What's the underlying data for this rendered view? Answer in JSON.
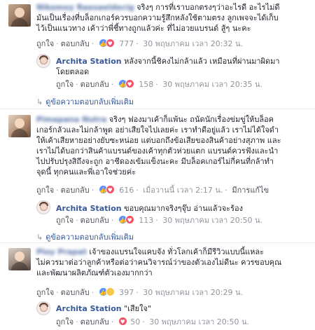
{
  "common": {
    "like": "ถูกใจ",
    "reply": "ตอบกลับ",
    "dot": "·",
    "view_more_replies": "ดูข้อความตอบกลับเพิ่มเติม",
    "edited": "มีการแก้ไข"
  },
  "comments": [
    {
      "author": "Nikomoy Raesaeldecig",
      "lines": [
        "จริงๆ การที่เราบอกตรงๆว่าอะไรดี อะไรไม่ดี",
        "มันเป็นเรื่องที่บล็อกเกอร์ควรบอกความรู้สึกหลังใช้ตามตรง ลูกเพจจะได้เก็บ",
        "ไว้เป็นแนวทาง เค้าว่าพี่ชี้ทางถูกแล้วค่ะ ที่ไม่อวยแบรนด์ สู้ๆ นะคะ"
      ],
      "reactions": "777",
      "time": "30 พฤษภาคม เวลา 20:32 น.",
      "reply": {
        "author": "Archita Station",
        "lines": [
          "หลังจากนี้ชิคงไม่กล้าแล้ว เหมือนที่ผ่านมาผิดมา",
          "โดยตลอด"
        ],
        "reactions": "158",
        "time": "30 พฤษภาคม เวลา 20:35 น."
      }
    },
    {
      "author": "Pimapana Nutra",
      "lines": [
        "จริงๆ ฟองมาเค้าก็แพ้นะ ถนัดนักเรื่องข่มขู่ให้บล็อค",
        "เกอร์กลัวและไม่กล้าพูด อย่าเสียใจไปเลยค่ะ เราทำดีอยู่แล้ว เราไม่ได้ใจดำ",
        "ให้เค้าเสียหายอย่างยับซะหน่อย แต่บอกถึงข้อเสียของสินค้าอย่างสุภาพ และ",
        "เราไม่ได้บอกว่าสินค้าแบรนด์ของเค้าทุกตัวห่วยแตก แบรนด์ควรฟังและนำ",
        "ไปปรับปรุงสิถึงจะถูก อาชีดองเข้มแข็งนะคะ มีบล็อคเกอร์ไม่กี่คนที่กล้าทำ",
        "จุดนี้ ทุกคนและพี่เอาใจช่วยค่ะ"
      ],
      "reactions": "616",
      "time": "เมื่อวานนี้ เวลา 2:17 น.",
      "reply": {
        "author": "Archita Station",
        "lines": [
          "ขอบคุณมากจริงๆจุ๊บ อ่านแล้วจะร้อง"
        ],
        "reactions": "113",
        "time": "30 พฤษภาคม เวลา 20:50 น."
      }
    },
    {
      "author": "Ploy Prapat",
      "lines": [
        "เจ้าของแบรนใจแคบจัง ทั่วโลกเค้าก็มีรีวิวแบบนี้แหละ",
        "ไม่ควรมาต่อว่าลูกค้าหรือต่อว่าคนวิจารณ์ว่าของตัวเองไม่ดีนะ ควรขอบคุณ",
        "และพัฒนาผลิตภัณฑ์ตัวเองมากกว่า"
      ],
      "reactions": "397",
      "time": "30 พฤษภาคม เวลา 20:29 น.",
      "reply": {
        "author": "Archita Station",
        "lines": [
          "\"เสียใจ\""
        ],
        "reactions": "50",
        "time": "30 พฤษภาคม เวลา 20:50 น."
      }
    }
  ]
}
